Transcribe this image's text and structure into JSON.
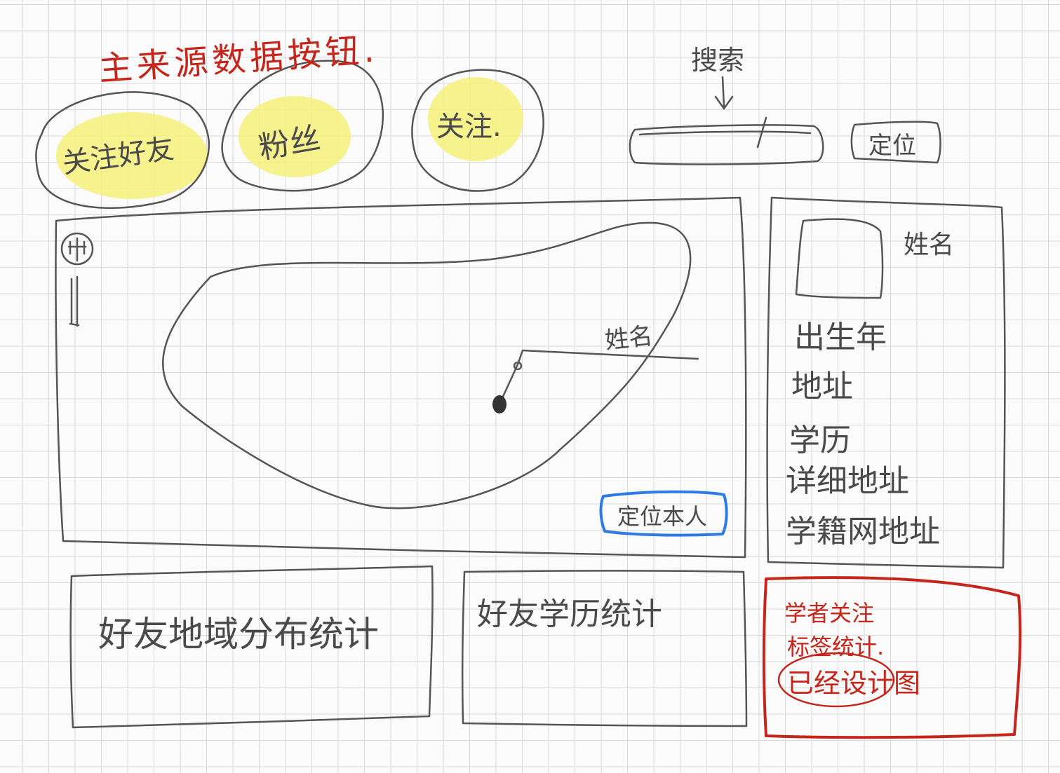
{
  "header": {
    "title": "主来源数据按钮."
  },
  "source_buttons": [
    {
      "label": "关注好友"
    },
    {
      "label": "粉丝"
    },
    {
      "label": "关注."
    }
  ],
  "search": {
    "hint_label": "搜索",
    "locate_button": "定位"
  },
  "map": {
    "marker_label": "姓名",
    "locate_button": "定位本人"
  },
  "profile_panel": {
    "name": "姓名",
    "fields": [
      "出生年",
      "地址",
      "学历",
      "详细地址",
      "学籍网地址"
    ]
  },
  "stats": {
    "region_chart": "好友地域分布统计",
    "education_chart": "好友学历统计",
    "interest_title_line1": "学者关注",
    "interest_title_line2": "标签统计.",
    "interest_note": "已经设计图"
  },
  "colors": {
    "ink": "#555555",
    "red": "#c4261c",
    "blue": "#2f7be6",
    "highlight": "#f4f07a"
  }
}
